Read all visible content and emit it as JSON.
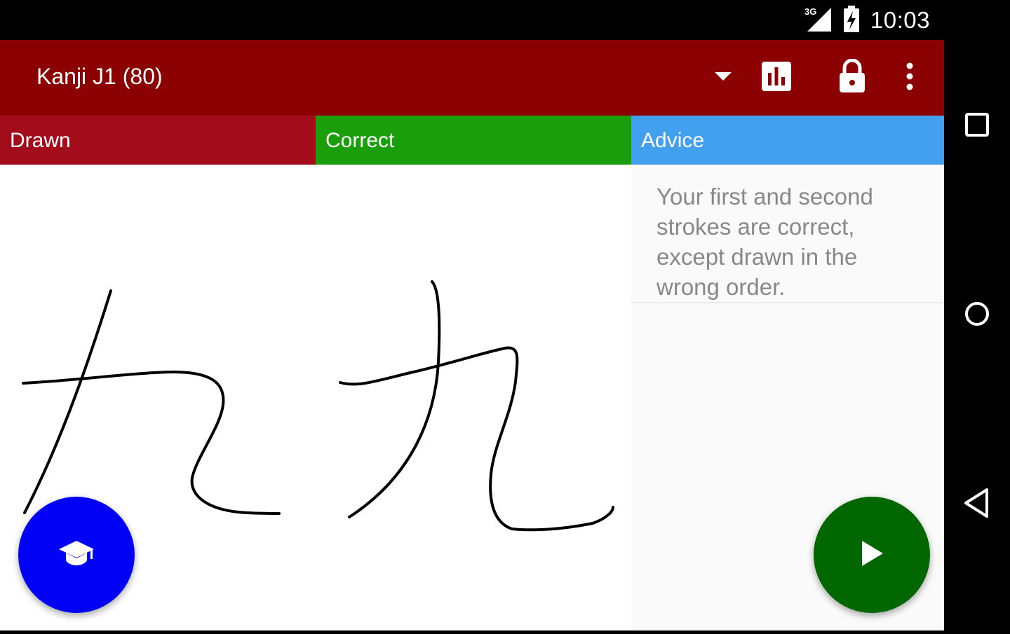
{
  "status_bar": {
    "network_label": "3G",
    "time": "10:03"
  },
  "toolbar": {
    "title": "Kanji J1 (80)",
    "icons": [
      "dropdown-arrow-icon",
      "bar-chart-icon",
      "lock-icon",
      "overflow-menu-icon"
    ]
  },
  "tabs": [
    {
      "label": "Drawn",
      "color": "#a30d1b"
    },
    {
      "label": "Correct",
      "color": "#1a9e0b"
    },
    {
      "label": "Advice",
      "color": "#43a0ee"
    }
  ],
  "advice": {
    "text": "Your first and second strokes are correct, except drawn in the wrong order."
  },
  "fabs": {
    "learn_icon": "graduation-cap-icon",
    "learn_color": "#0000f5",
    "play_icon": "play-icon",
    "play_color": "#006600"
  },
  "colors": {
    "toolbar": "#8b0000",
    "status_bar": "#000000"
  }
}
